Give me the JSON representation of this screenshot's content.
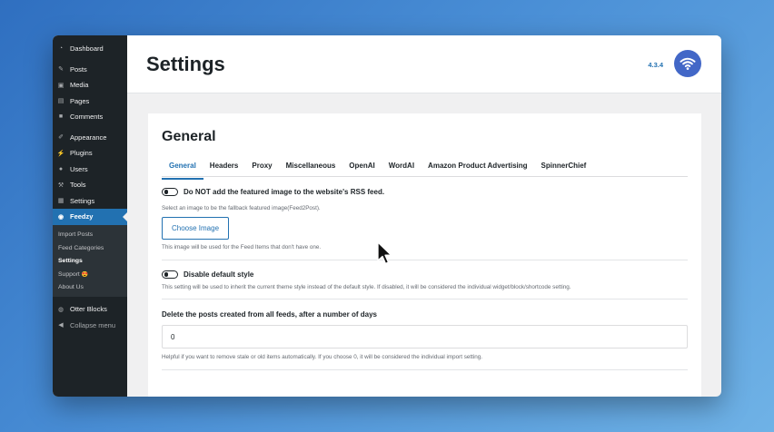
{
  "sidebar": {
    "items": [
      {
        "label": "Dashboard",
        "icon": "dashboard-icon"
      },
      {
        "label": "Posts",
        "icon": "pin-icon"
      },
      {
        "label": "Media",
        "icon": "media-icon"
      },
      {
        "label": "Pages",
        "icon": "page-icon"
      },
      {
        "label": "Comments",
        "icon": "comment-icon"
      },
      {
        "label": "Appearance",
        "icon": "brush-icon"
      },
      {
        "label": "Plugins",
        "icon": "plugin-icon"
      },
      {
        "label": "Users",
        "icon": "user-icon"
      },
      {
        "label": "Tools",
        "icon": "wrench-icon"
      },
      {
        "label": "Settings",
        "icon": "settings-icon"
      },
      {
        "label": "Feedzy",
        "icon": "feedzy-icon"
      }
    ],
    "submenu": [
      "Import Posts",
      "Feed Categories",
      "Settings",
      "Support",
      "About Us"
    ],
    "support_emoji": "😍",
    "bottom": [
      {
        "label": "Otter Blocks",
        "icon": "otter-icon"
      },
      {
        "label": "Collapse menu",
        "icon": "collapse-icon"
      }
    ]
  },
  "header": {
    "title": "Settings",
    "version": "4.3.4"
  },
  "general": {
    "title": "General",
    "tabs": [
      "General",
      "Headers",
      "Proxy",
      "Miscellaneous",
      "OpenAI",
      "WordAI",
      "Amazon Product Advertising",
      "SpinnerChief"
    ],
    "featured_toggle_label": "Do NOT add the featured image to the website's RSS feed.",
    "fallback_help": "Select an image to be the fallback featured image(Feed2Post).",
    "choose_image_label": "Choose Image",
    "choose_image_help": "This image will be used for the Feed Items that don't have one.",
    "disable_style_label": "Disable default style",
    "disable_style_help": "This setting will be used to inherit the current theme style instead of the default style. If disabled, it will be considered the individual widget/block/shortcode setting.",
    "delete_label": "Delete the posts created from all feeds, after a number of days",
    "delete_value": "0",
    "delete_help": "Helpful if you want to remove stale or old items automatically. If you choose 0, it will be considered the individual import setting."
  },
  "colors": {
    "accent": "#2271b1",
    "sidebar_bg": "#1d2327",
    "logo_bg": "#4267c7"
  }
}
